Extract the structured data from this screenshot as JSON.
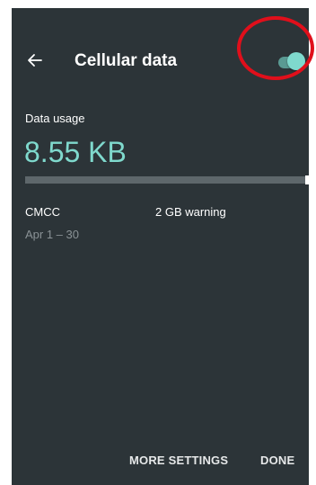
{
  "header": {
    "title": "Cellular data",
    "back_icon": "arrow-left-icon",
    "toggle_on": true
  },
  "usage": {
    "label": "Data usage",
    "value": "8.55 KB",
    "bar_fill_fraction": 0.0,
    "warning_marker_fraction": 1.0
  },
  "plan": {
    "carrier": "CMCC",
    "warning": "2 GB warning",
    "cycle": "Apr 1 – 30"
  },
  "footer": {
    "more_settings_label": "MORE SETTINGS",
    "done_label": "DONE"
  },
  "colors": {
    "background": "#2c3438",
    "accent": "#7fd9cd",
    "highlight": "#e00f1b"
  }
}
